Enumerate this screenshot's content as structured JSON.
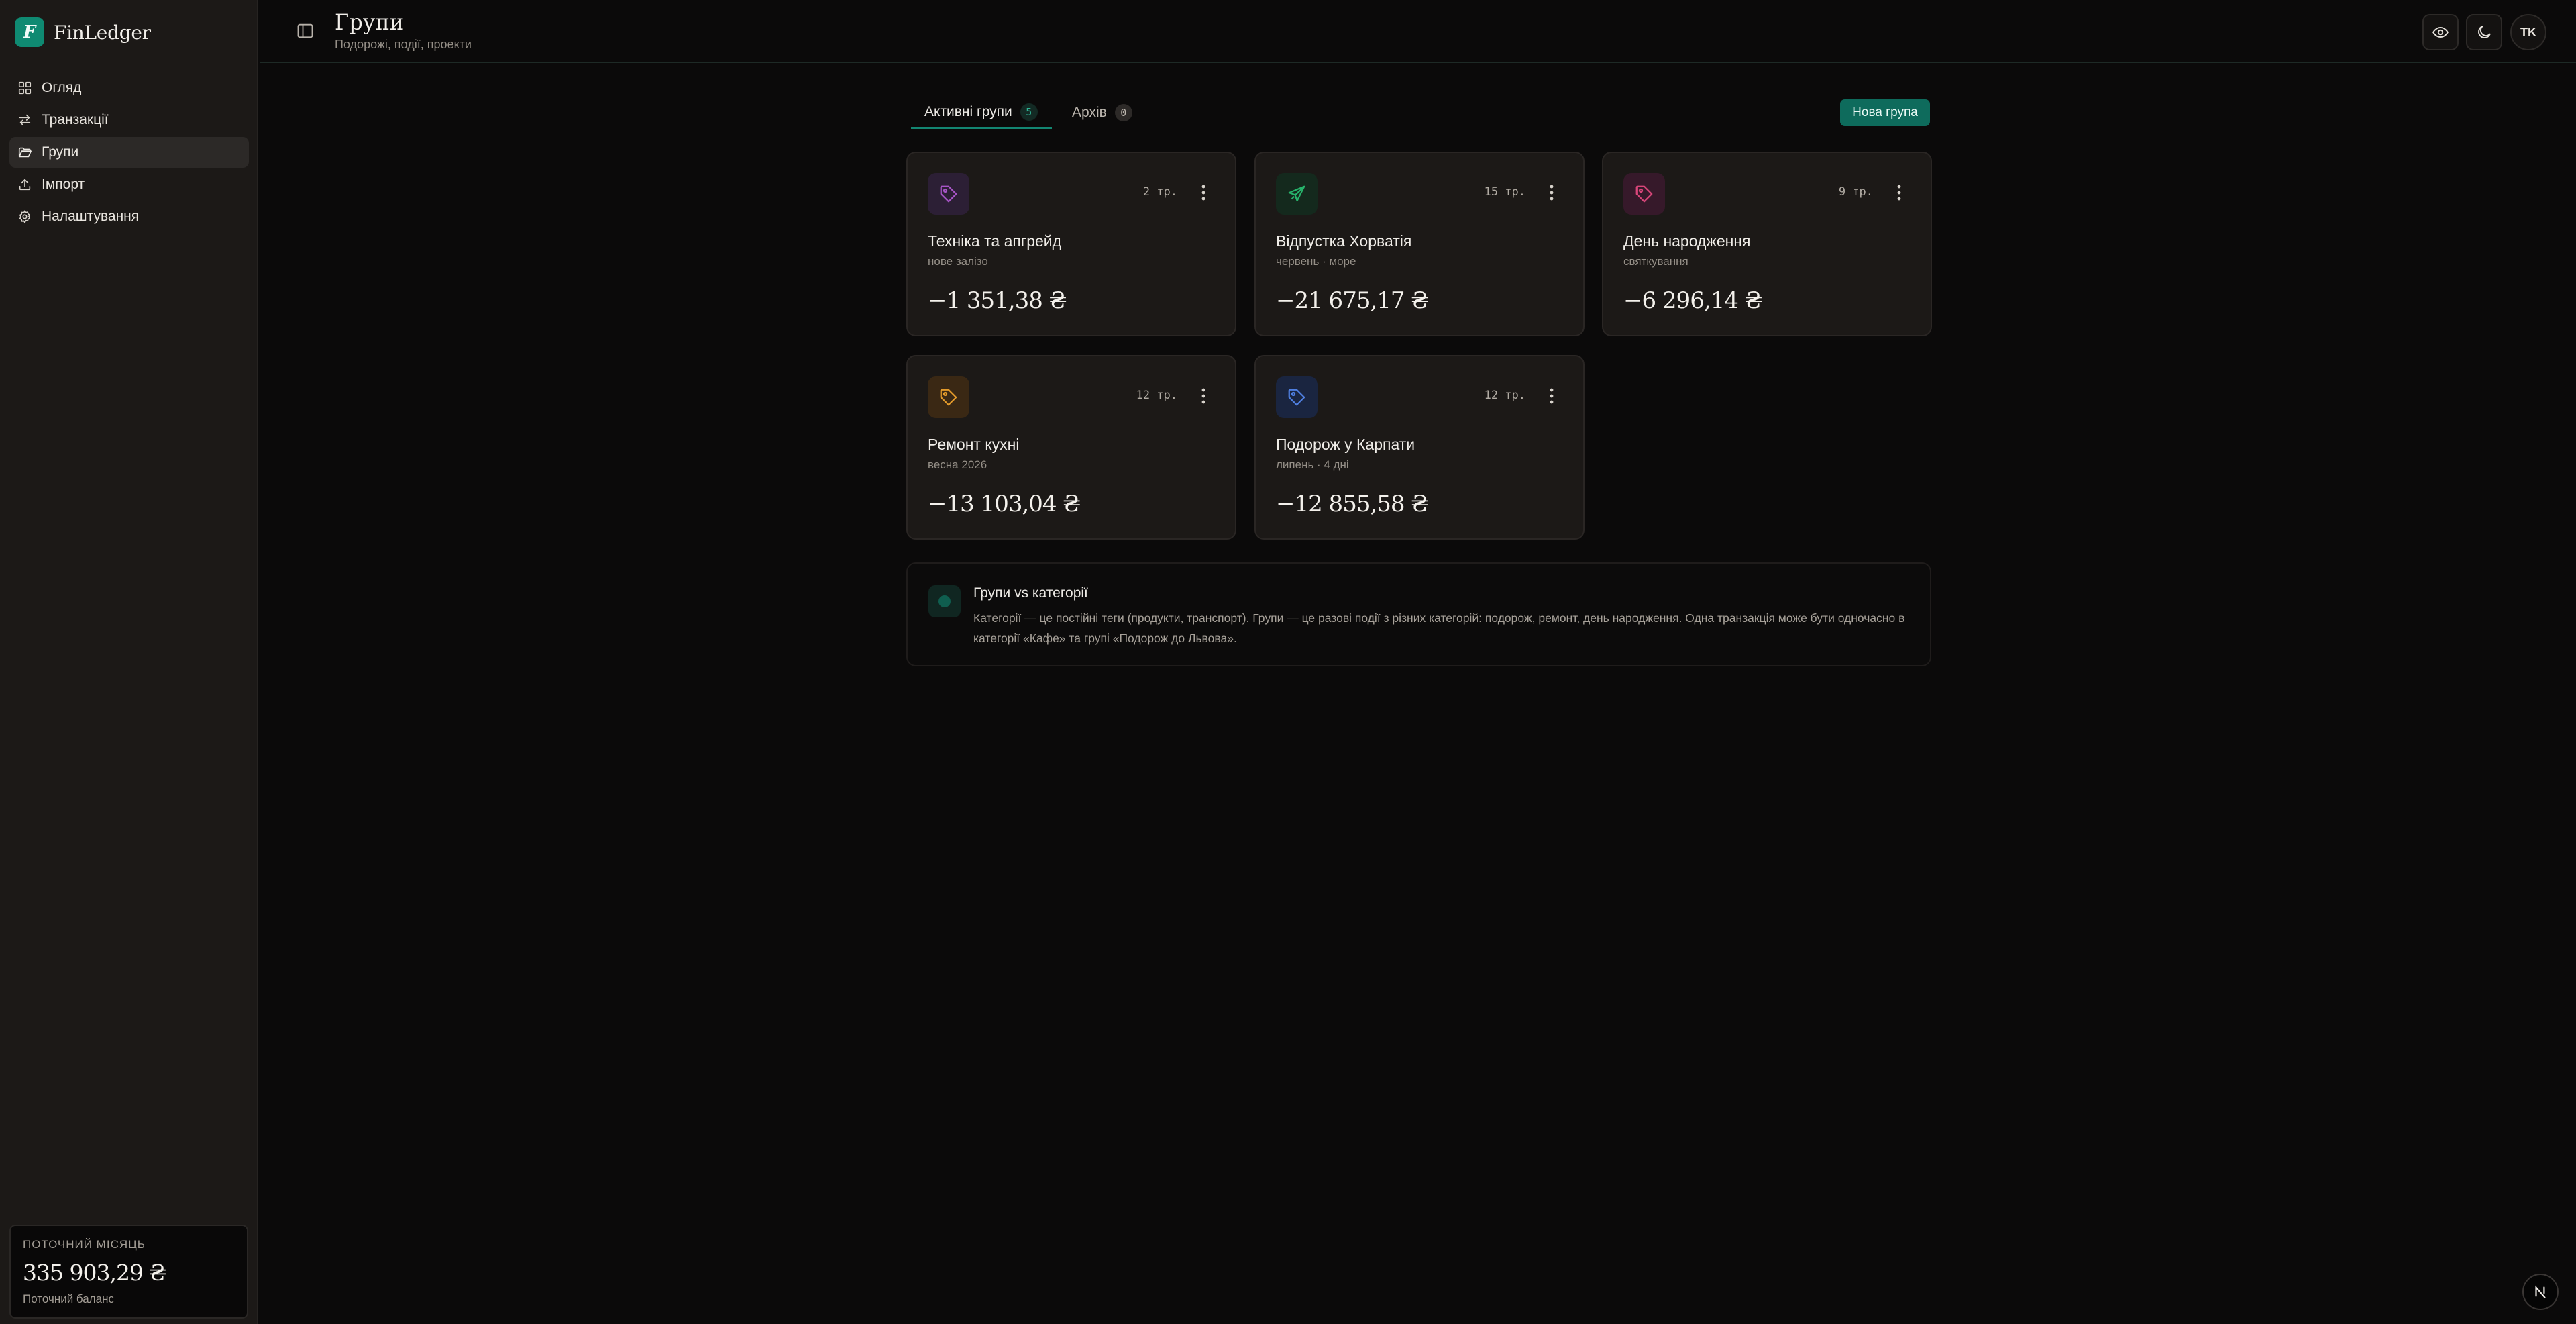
{
  "brand": {
    "logo_letter": "F",
    "name": "FinLedger",
    "accent": "#0f8a72"
  },
  "sidebar": {
    "items": [
      {
        "label": "Огляд",
        "icon": "grid-icon",
        "active": false
      },
      {
        "label": "Транзакції",
        "icon": "arrows-swap-icon",
        "active": false
      },
      {
        "label": "Групи",
        "icon": "folder-icon",
        "active": true
      },
      {
        "label": "Імпорт",
        "icon": "upload-icon",
        "active": false
      },
      {
        "label": "Налаштування",
        "icon": "gear-icon",
        "active": false
      }
    ],
    "balance": {
      "label": "Поточний місяць",
      "value": "335 903,29 ₴",
      "sub": "Поточний баланс"
    }
  },
  "header": {
    "title": "Групи",
    "subtitle": "Подорожі, події, проекти",
    "avatar_initials": "TK"
  },
  "tabs": [
    {
      "label": "Активні групи",
      "count": "5",
      "active": true
    },
    {
      "label": "Архів",
      "count": "0",
      "active": false
    }
  ],
  "new_group_label": "Нова група",
  "groups": [
    {
      "title": "Техніка та апгрейд",
      "subtitle": "нове залізо",
      "count": "2 тр.",
      "amount": "−1 351,38 ₴",
      "icon": "tag-icon",
      "color": "#a855c7",
      "icon_bg": "#2c1f35"
    },
    {
      "title": "Відпустка Хорватія",
      "subtitle": "червень · море",
      "count": "15 тр.",
      "amount": "−21 675,17 ₴",
      "icon": "plane-icon",
      "color": "#27b36b",
      "icon_bg": "#14291d"
    },
    {
      "title": "День народження",
      "subtitle": "святкування",
      "count": "9 тр.",
      "amount": "−6 296,14 ₴",
      "icon": "tag-icon",
      "color": "#d9467a",
      "icon_bg": "#36192a"
    },
    {
      "title": "Ремонт кухні",
      "subtitle": "весна 2026",
      "count": "12 тр.",
      "amount": "−13 103,04 ₴",
      "icon": "tag-icon",
      "color": "#e39a2b",
      "icon_bg": "#3a2814"
    },
    {
      "title": "Подорож у Карпати",
      "subtitle": "липень · 4 дні",
      "count": "12 тр.",
      "amount": "−12 855,58 ₴",
      "icon": "tag-icon",
      "color": "#4f7fe0",
      "icon_bg": "#1a2540"
    }
  ],
  "info": {
    "title": "Групи vs категорії",
    "text": "Категорії — це постійні теги (продукти, транспорт). Групи — це разові події з різних категорій: подорож, ремонт, день народження. Одна транзакція може бути одночасно в категорії «Кафе» та групі «Подорож до Львова»."
  }
}
